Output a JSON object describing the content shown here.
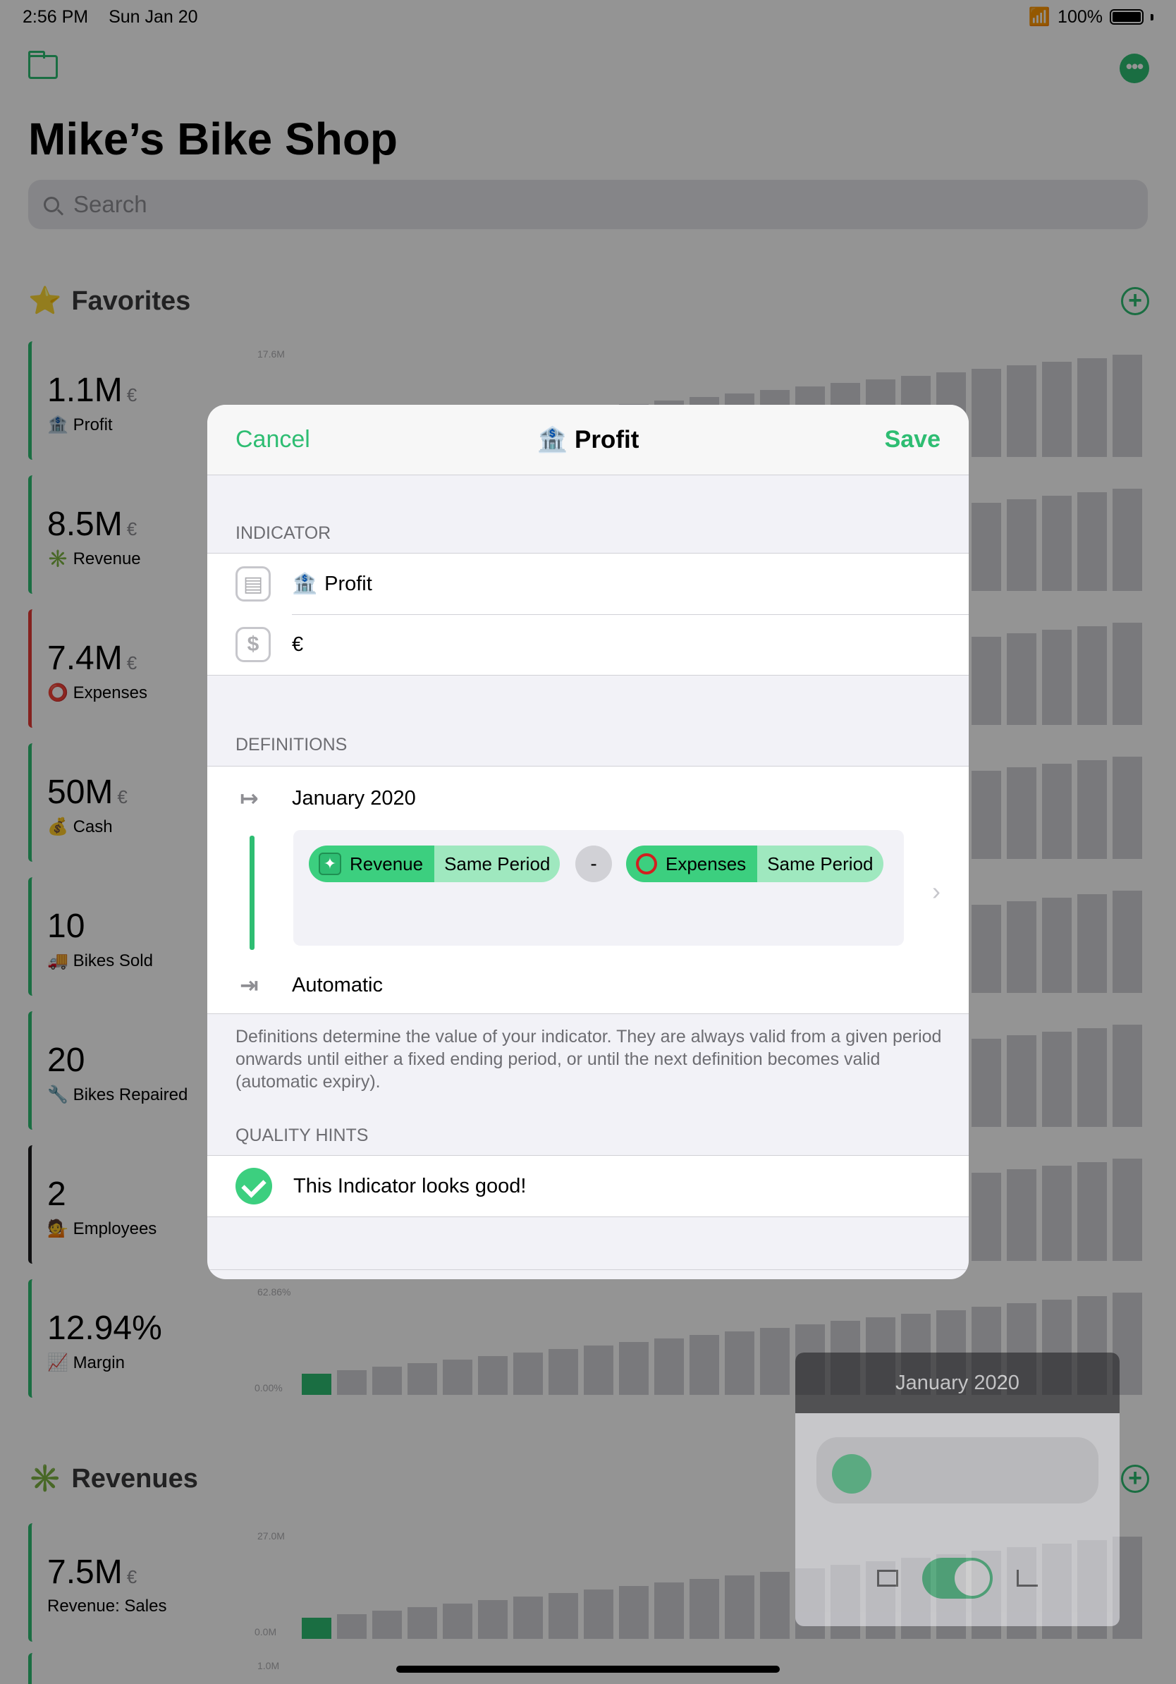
{
  "status_bar": {
    "time": "2:56 PM",
    "date": "Sun Jan 20",
    "battery": "100%"
  },
  "app": {
    "title": "Mike’s Bike Shop",
    "search_placeholder": "Search",
    "favorites_title": "Favorites",
    "favorites_emoji": "⭐",
    "revenues_title": "Revenues",
    "revenues_emoji": "✳️"
  },
  "cards": [
    {
      "value": "1.1M",
      "unit": "€",
      "emoji": "🏦",
      "label": "Profit",
      "accent": "#2ebd72",
      "axis_max": "17.6M"
    },
    {
      "value": "8.5M",
      "unit": "€",
      "emoji": "✳️",
      "label": "Revenue",
      "accent": "#2ebd72"
    },
    {
      "value": "7.4M",
      "unit": "€",
      "emoji": "⭕",
      "label": "Expenses",
      "accent": "#e53935"
    },
    {
      "value": "50M",
      "unit": "€",
      "emoji": "💰",
      "label": "Cash",
      "accent": "#2ebd72"
    },
    {
      "value": "10",
      "unit": "",
      "emoji": "🚚",
      "label": "Bikes Sold",
      "accent": "#2ebd72"
    },
    {
      "value": "20",
      "unit": "",
      "emoji": "🔧",
      "label": "Bikes Repaired",
      "accent": "#2ebd72"
    },
    {
      "value": "2",
      "unit": "",
      "emoji": "💁",
      "label": "Employees",
      "accent": "#1c1c1e"
    },
    {
      "value": "12.94%",
      "unit": "",
      "emoji": "📈",
      "label": "Margin",
      "accent": "#2ebd72",
      "axis_max": "62.86%",
      "axis_min": "0.00%"
    }
  ],
  "revenue_cards": [
    {
      "value": "7.5M",
      "unit": "€",
      "label": "Revenue: Sales",
      "accent": "#2ebd72",
      "axis_max": "27.0M",
      "axis_min": "0.0M"
    },
    {
      "axis_max": "1.0M"
    }
  ],
  "sheet": {
    "cancel": "Cancel",
    "title_emoji": "🏦",
    "title": "Profit",
    "save": "Save",
    "indicator_header": "INDICATOR",
    "indicator_name": "Profit",
    "indicator_name_emoji": "🏦",
    "indicator_unit": "€",
    "definitions_header": "DEFINITIONS",
    "start_period": "January 2020",
    "end_period": "Automatic",
    "formula": {
      "left": {
        "emoji": "✳️",
        "name": "Revenue",
        "period": "Same Period"
      },
      "operator": "-",
      "right": {
        "emoji": "⭕",
        "name": "Expenses",
        "period": "Same Period"
      }
    },
    "definitions_footnote": "Definitions determine the value of your indicator. They are always valid from a given period onwards until either a fixed ending period, or until the next definition becomes valid (automatic expiry).",
    "quality_header": "QUALITY HINTS",
    "quality_message": "This Indicator looks good!"
  },
  "popover": {
    "title": "January 2020"
  },
  "colors": {
    "accent": "#2ebd72",
    "expense": "#e53935"
  }
}
